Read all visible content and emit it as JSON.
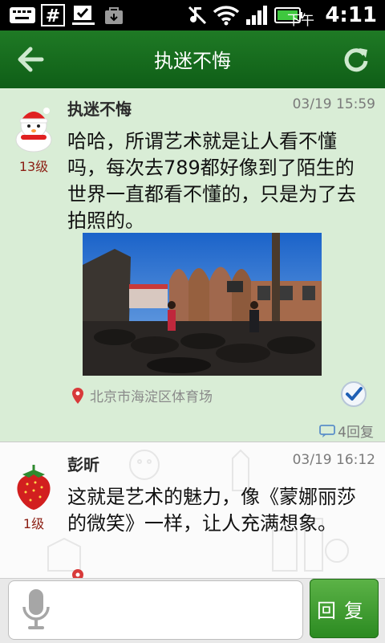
{
  "status_bar": {
    "ampm": "下午",
    "time": "4:11",
    "icons": [
      "keyboard-icon",
      "hash-icon",
      "check-download-icon",
      "bag-icon",
      "mute-icon",
      "wifi-icon",
      "signal-icon",
      "battery-icon"
    ]
  },
  "header": {
    "title": "执迷不悔",
    "back_icon": "back-arrow-icon",
    "refresh_icon": "refresh-icon"
  },
  "posts": [
    {
      "author": "执迷不悔",
      "time": "03/19 15:59",
      "level": "13级",
      "content": "哈哈，所谓艺术就是让人看不懂吗，每次去789都好像到了陌生的世界一直都看不懂的，只是为了去拍照的。",
      "location": "北京市海淀区体育场",
      "reply_count": "4回复",
      "avatar": "snowman-avatar"
    },
    {
      "author": "彭昕",
      "time": "03/19 16:12",
      "level": "1级",
      "content": "这就是艺术的魅力，像《蒙娜丽莎的微笑》一样，让人充满想象。",
      "avatar": "strawberry-avatar"
    }
  ],
  "bottom_bar": {
    "reply_label": "回复",
    "mic_icon": "microphone-icon"
  },
  "colors": {
    "header_green": "#1f7a25",
    "post_highlight": "#d9edd6",
    "level_red": "#8c1f14",
    "reply_button": "#3d9a2e"
  }
}
